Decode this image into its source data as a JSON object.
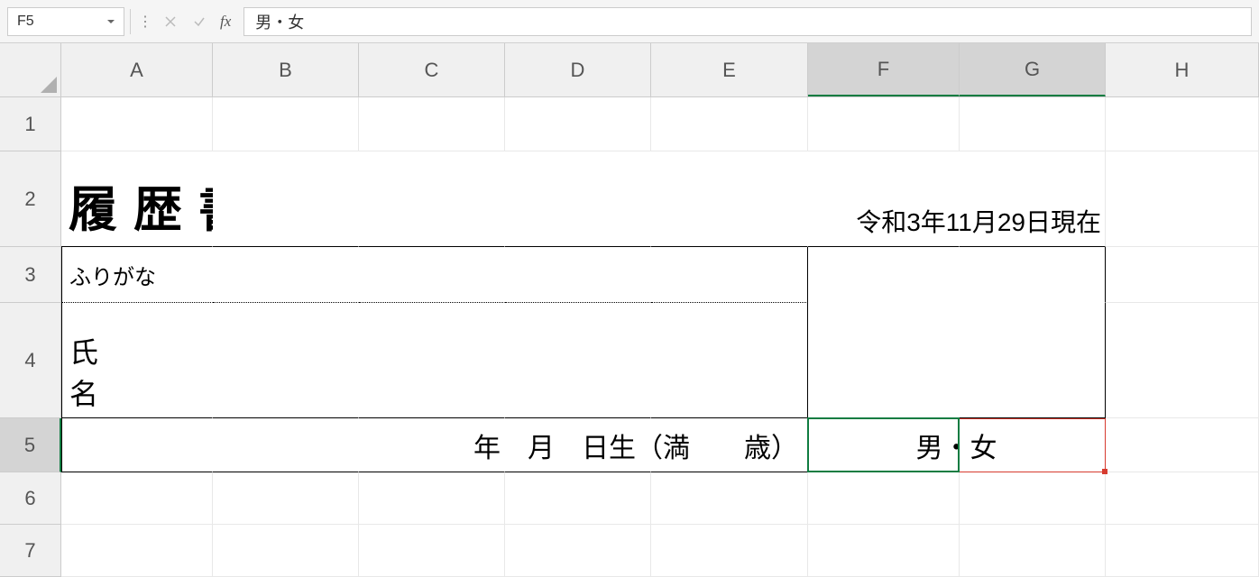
{
  "nameBox": "F5",
  "formulaValue": "男・女",
  "fxLabel": "fx",
  "columns": [
    "A",
    "B",
    "C",
    "D",
    "E",
    "F",
    "G",
    "H"
  ],
  "rows": [
    "1",
    "2",
    "3",
    "4",
    "5",
    "6",
    "7"
  ],
  "selectedCols": [
    "F",
    "G"
  ],
  "selectedRow": "5",
  "cells": {
    "title": "履歴書",
    "date": "令和3年11月29日現在",
    "furigana": "ふりがな",
    "shimei": "氏　名",
    "birth": "年　月　日生（満　　歳）",
    "gender": "男・女"
  }
}
